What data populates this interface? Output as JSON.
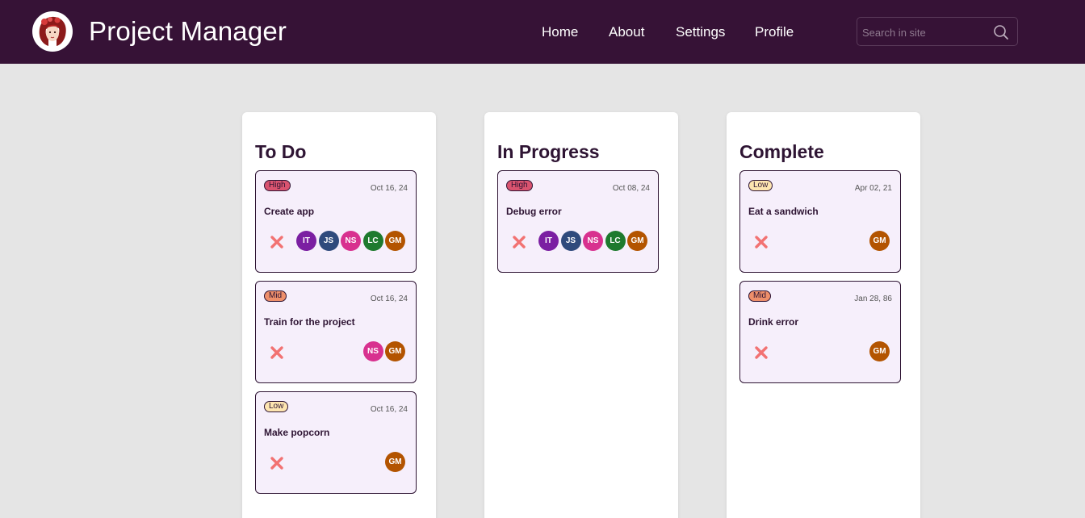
{
  "header": {
    "title": "Project Manager",
    "logo_icon": "avatar-logo-icon",
    "nav": [
      "Home",
      "About",
      "Settings",
      "Profile"
    ],
    "search_placeholder": "Search in site",
    "search_icon": "search-icon"
  },
  "colors": {
    "header_bg": "#361236",
    "page_bg": "#e5e5e5",
    "card_bg": "#f6effb",
    "text_dark": "#2e1433",
    "priority_high": "#d9536f",
    "priority_mid": "#ee8f6a",
    "priority_low": "#fde5b0",
    "delete_icon": "#f27272"
  },
  "members": {
    "IT": "#7b1fa2",
    "JS": "#2f4a7c",
    "NS": "#d8318f",
    "LC": "#1e7a2e",
    "GM": "#b35400"
  },
  "columns": [
    {
      "title": "To Do",
      "cards": [
        {
          "priority": "High",
          "date": "Oct 16, 24",
          "title": "Create app",
          "members": [
            "IT",
            "JS",
            "NS",
            "LC",
            "GM"
          ]
        },
        {
          "priority": "Mid",
          "date": "Oct 16, 24",
          "title": "Train for the project",
          "members": [
            "NS",
            "GM"
          ]
        },
        {
          "priority": "Low",
          "date": "Oct 16, 24",
          "title": "Make popcorn",
          "members": [
            "GM"
          ]
        }
      ]
    },
    {
      "title": "In Progress",
      "cards": [
        {
          "priority": "High",
          "date": "Oct 08, 24",
          "title": "Debug error",
          "members": [
            "IT",
            "JS",
            "NS",
            "LC",
            "GM"
          ]
        }
      ]
    },
    {
      "title": "Complete",
      "cards": [
        {
          "priority": "Low",
          "date": "Apr 02, 21",
          "title": "Eat a sandwich",
          "members": [
            "GM"
          ]
        },
        {
          "priority": "Mid",
          "date": "Jan 28, 86",
          "title": "Drink error",
          "members": [
            "GM"
          ]
        }
      ]
    }
  ],
  "card_delete_icon": "close-x-icon"
}
